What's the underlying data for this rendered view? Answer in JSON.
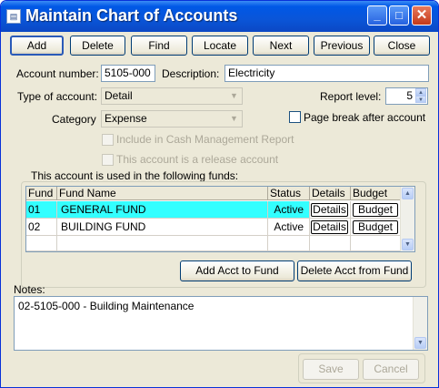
{
  "window": {
    "title": "Maintain Chart of Accounts",
    "minimize": "_",
    "maximize": "□",
    "close": "✕"
  },
  "toolbar": {
    "add": "Add",
    "delete": "Delete",
    "find": "Find",
    "locate": "Locate",
    "next": "Next",
    "previous": "Previous",
    "close": "Close"
  },
  "form": {
    "account_number_label": "Account number:",
    "account_number": "5105-000",
    "description_label": "Description:",
    "description": "Electricity",
    "type_label": "Type of account:",
    "type_value": "Detail",
    "report_level_label": "Report level:",
    "report_level": "5",
    "category_label": "Category",
    "category_value": "Expense",
    "page_break_label": "Page break after account",
    "include_cash_label": "Include in Cash Management Report",
    "release_label": "This account is a release account",
    "funds_label": "This account is used in the following funds:"
  },
  "funds_table": {
    "columns": [
      "Fund",
      "Fund Name",
      "Status",
      "Details",
      "Budget"
    ],
    "rows": [
      {
        "fund": "01",
        "name": "GENERAL FUND",
        "status": "Active",
        "details": "Details",
        "budget": "Budget",
        "selected": true
      },
      {
        "fund": "02",
        "name": "BUILDING FUND",
        "status": "Active",
        "details": "Details",
        "budget": "Budget",
        "selected": false
      }
    ]
  },
  "fund_actions": {
    "add_acct": "Add Acct to Fund",
    "delete_acct": "Delete Acct from Fund"
  },
  "notes": {
    "label": "Notes:",
    "text": "02-5105-000 - Building Maintenance"
  },
  "footer": {
    "save": "Save",
    "cancel": "Cancel"
  },
  "colors": {
    "selection": "#33ffff",
    "titlebar": "#0058e6"
  }
}
